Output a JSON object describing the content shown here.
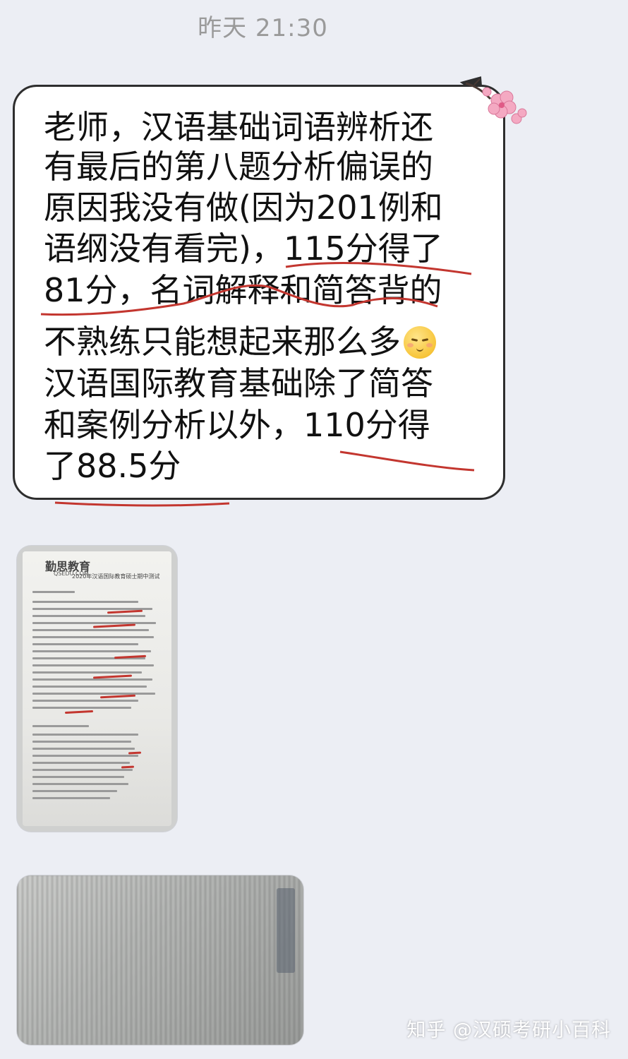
{
  "header": {
    "timestamp": "昨天 21:30"
  },
  "message": {
    "lines": [
      "老师，汉语基础词语辨析还",
      "有最后的第八题分析偏误的",
      "原因我没有做(因为201例和",
      "语纲没有看完)，115分得了",
      "81分，名词解释和简答背的",
      "不熟练只能想起来那么多",
      "汉语国际教育基础除了简答",
      "和案例分析以外，110分得",
      "了88.5分"
    ],
    "emoji": "pensive-face-icon"
  },
  "attachments": {
    "photo1": {
      "logo_text": "勤思教育",
      "logo_sub": "QSEDU.COM",
      "title": "2020年汉语国际教育硕士期中测试"
    },
    "photo2": {}
  },
  "watermark": {
    "text": "知乎 @汉硕考研小百科"
  },
  "colors": {
    "background": "#eceef4",
    "bubble_border": "#2e2e2e",
    "annotation_red": "#c3362f"
  }
}
